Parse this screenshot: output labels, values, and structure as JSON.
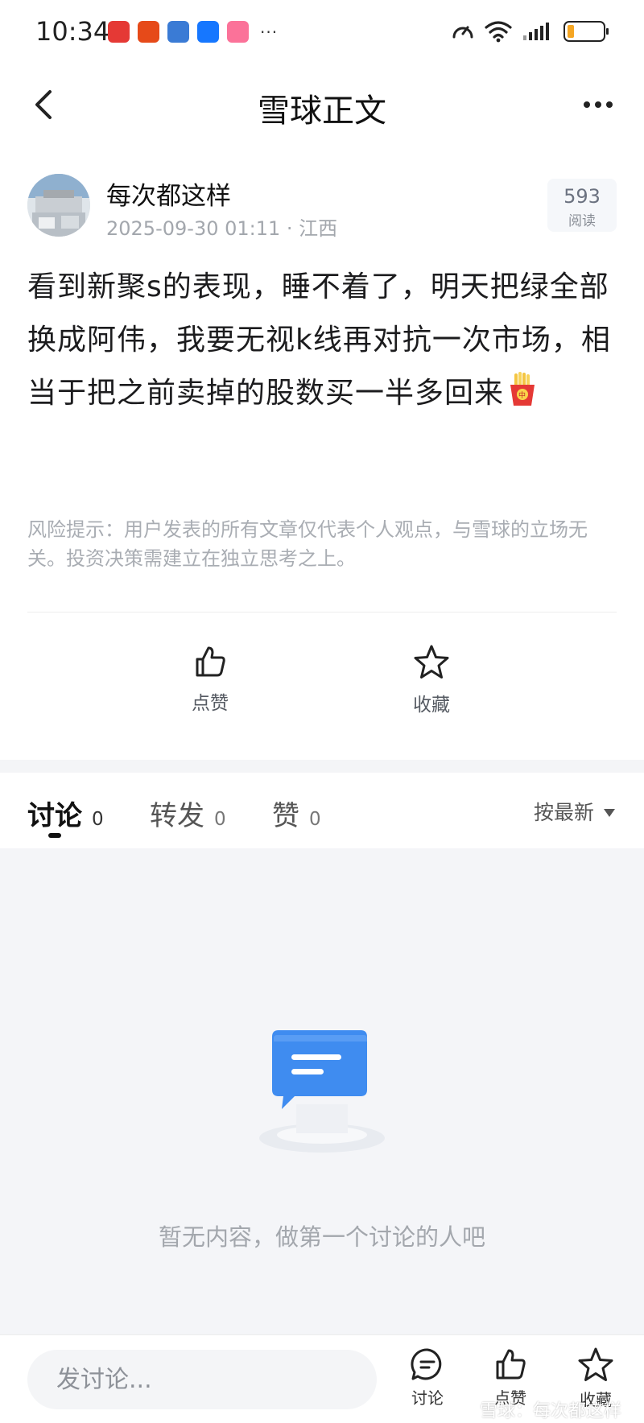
{
  "status_bar": {
    "time": "10:34",
    "battery_level": 0.2,
    "notification_icons": [
      {
        "name": "huawei-app-icon",
        "color": "#e53935"
      },
      {
        "name": "alert-app-icon",
        "color": "#e64a19"
      },
      {
        "name": "stock-chart-app-icon",
        "color": "#3a7bd5"
      },
      {
        "name": "alipay-icon",
        "color": "#1677ff"
      },
      {
        "name": "bilibili-icon",
        "color": "#fb7299"
      }
    ],
    "more_indicator": "···"
  },
  "nav": {
    "title": "雪球正文"
  },
  "author": {
    "name": "每次都这样",
    "meta": "2025-09-30 01:11 · 江西",
    "read_count": "593",
    "read_label": "阅读"
  },
  "post": {
    "text": "看到新聚s的表现，睡不着了，明天把绿全部换成阿伟，我要无视k线再对抗一次市场，相当于把之前卖掉的股数买一半多回来",
    "emoji": "fries-emoji",
    "risk_note": "风险提示：用户发表的所有文章仅代表个人观点，与雪球的立场无关。投资决策需建立在独立思考之上。"
  },
  "actions": {
    "like_label": "点赞",
    "collect_label": "收藏"
  },
  "tabs": {
    "items": [
      {
        "label": "讨论",
        "count": "0"
      },
      {
        "label": "转发",
        "count": "0"
      },
      {
        "label": "赞",
        "count": "0"
      }
    ],
    "sort_label": "按最新"
  },
  "empty": {
    "message": "暂无内容，做第一个讨论的人吧"
  },
  "bottom_bar": {
    "input_placeholder": "发讨论...",
    "discuss_label": "讨论",
    "like_label": "点赞",
    "collect_label": "收藏",
    "watermark": "雪球：每次都这样"
  },
  "colors": {
    "accent_blue": "#3f8cf0",
    "text_primary": "#1c1c1e",
    "text_secondary": "#a3a7ad",
    "battery": "#f5a623"
  }
}
